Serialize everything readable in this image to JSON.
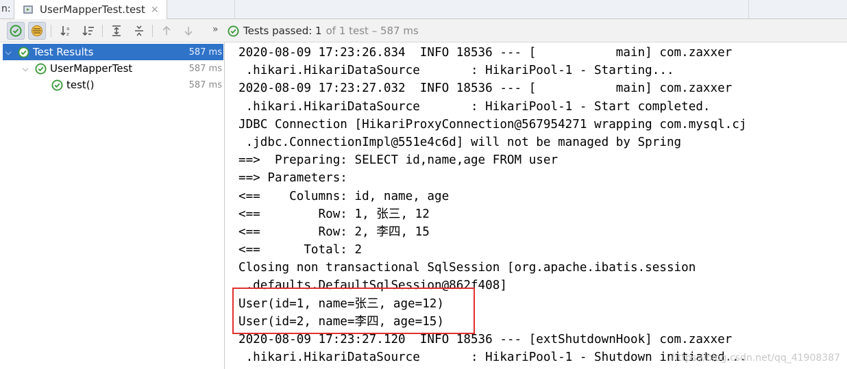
{
  "tabbar": {
    "prefix": "n:",
    "tab_title": "UserMapperTest.test",
    "close_glyph": "×"
  },
  "toolbar": {
    "status_main": "Tests passed: 1",
    "status_detail": "of 1 test – 587 ms",
    "overflow_glyph": "»"
  },
  "tree": {
    "items": [
      {
        "label": "Test Results",
        "time": "587 ms",
        "selected": true,
        "icon": "passed-check-icon"
      },
      {
        "label": "UserMapperTest",
        "time": "587 ms",
        "selected": false,
        "icon": "passed-check-icon"
      },
      {
        "label": "test()",
        "time": "587 ms",
        "selected": false,
        "icon": "passed-check-icon"
      }
    ]
  },
  "console": {
    "lines": [
      "2020-08-09 17:23:26.834  INFO 18536 --- [           main] com.zaxxer",
      " .hikari.HikariDataSource       : HikariPool-1 - Starting...",
      "2020-08-09 17:23:27.032  INFO 18536 --- [           main] com.zaxxer",
      " .hikari.HikariDataSource       : HikariPool-1 - Start completed.",
      "JDBC Connection [HikariProxyConnection@567954271 wrapping com.mysql.cj",
      " .jdbc.ConnectionImpl@551e4c6d] will not be managed by Spring",
      "==>  Preparing: SELECT id,name,age FROM user",
      "==> Parameters: ",
      "<==    Columns: id, name, age",
      "<==        Row: 1, 张三, 12",
      "<==        Row: 2, 李四, 15",
      "<==      Total: 2",
      "Closing non transactional SqlSession [org.apache.ibatis.session",
      " .defaults.DefaultSqlSession@862f408]",
      "User(id=1, name=张三, age=12)",
      "User(id=2, name=李四, age=15)",
      "2020-08-09 17:23:27.120  INFO 18536 --- [extShutdownHook] com.zaxxer",
      " .hikari.HikariDataSource       : HikariPool-1 - Shutdown initiated..."
    ],
    "watermark": "https://blog.csdn.net/qq_41908387"
  },
  "colors": {
    "selection": "#2f73c9",
    "pass_green": "#3c9a3c",
    "highlight_red": "#e0302c"
  }
}
